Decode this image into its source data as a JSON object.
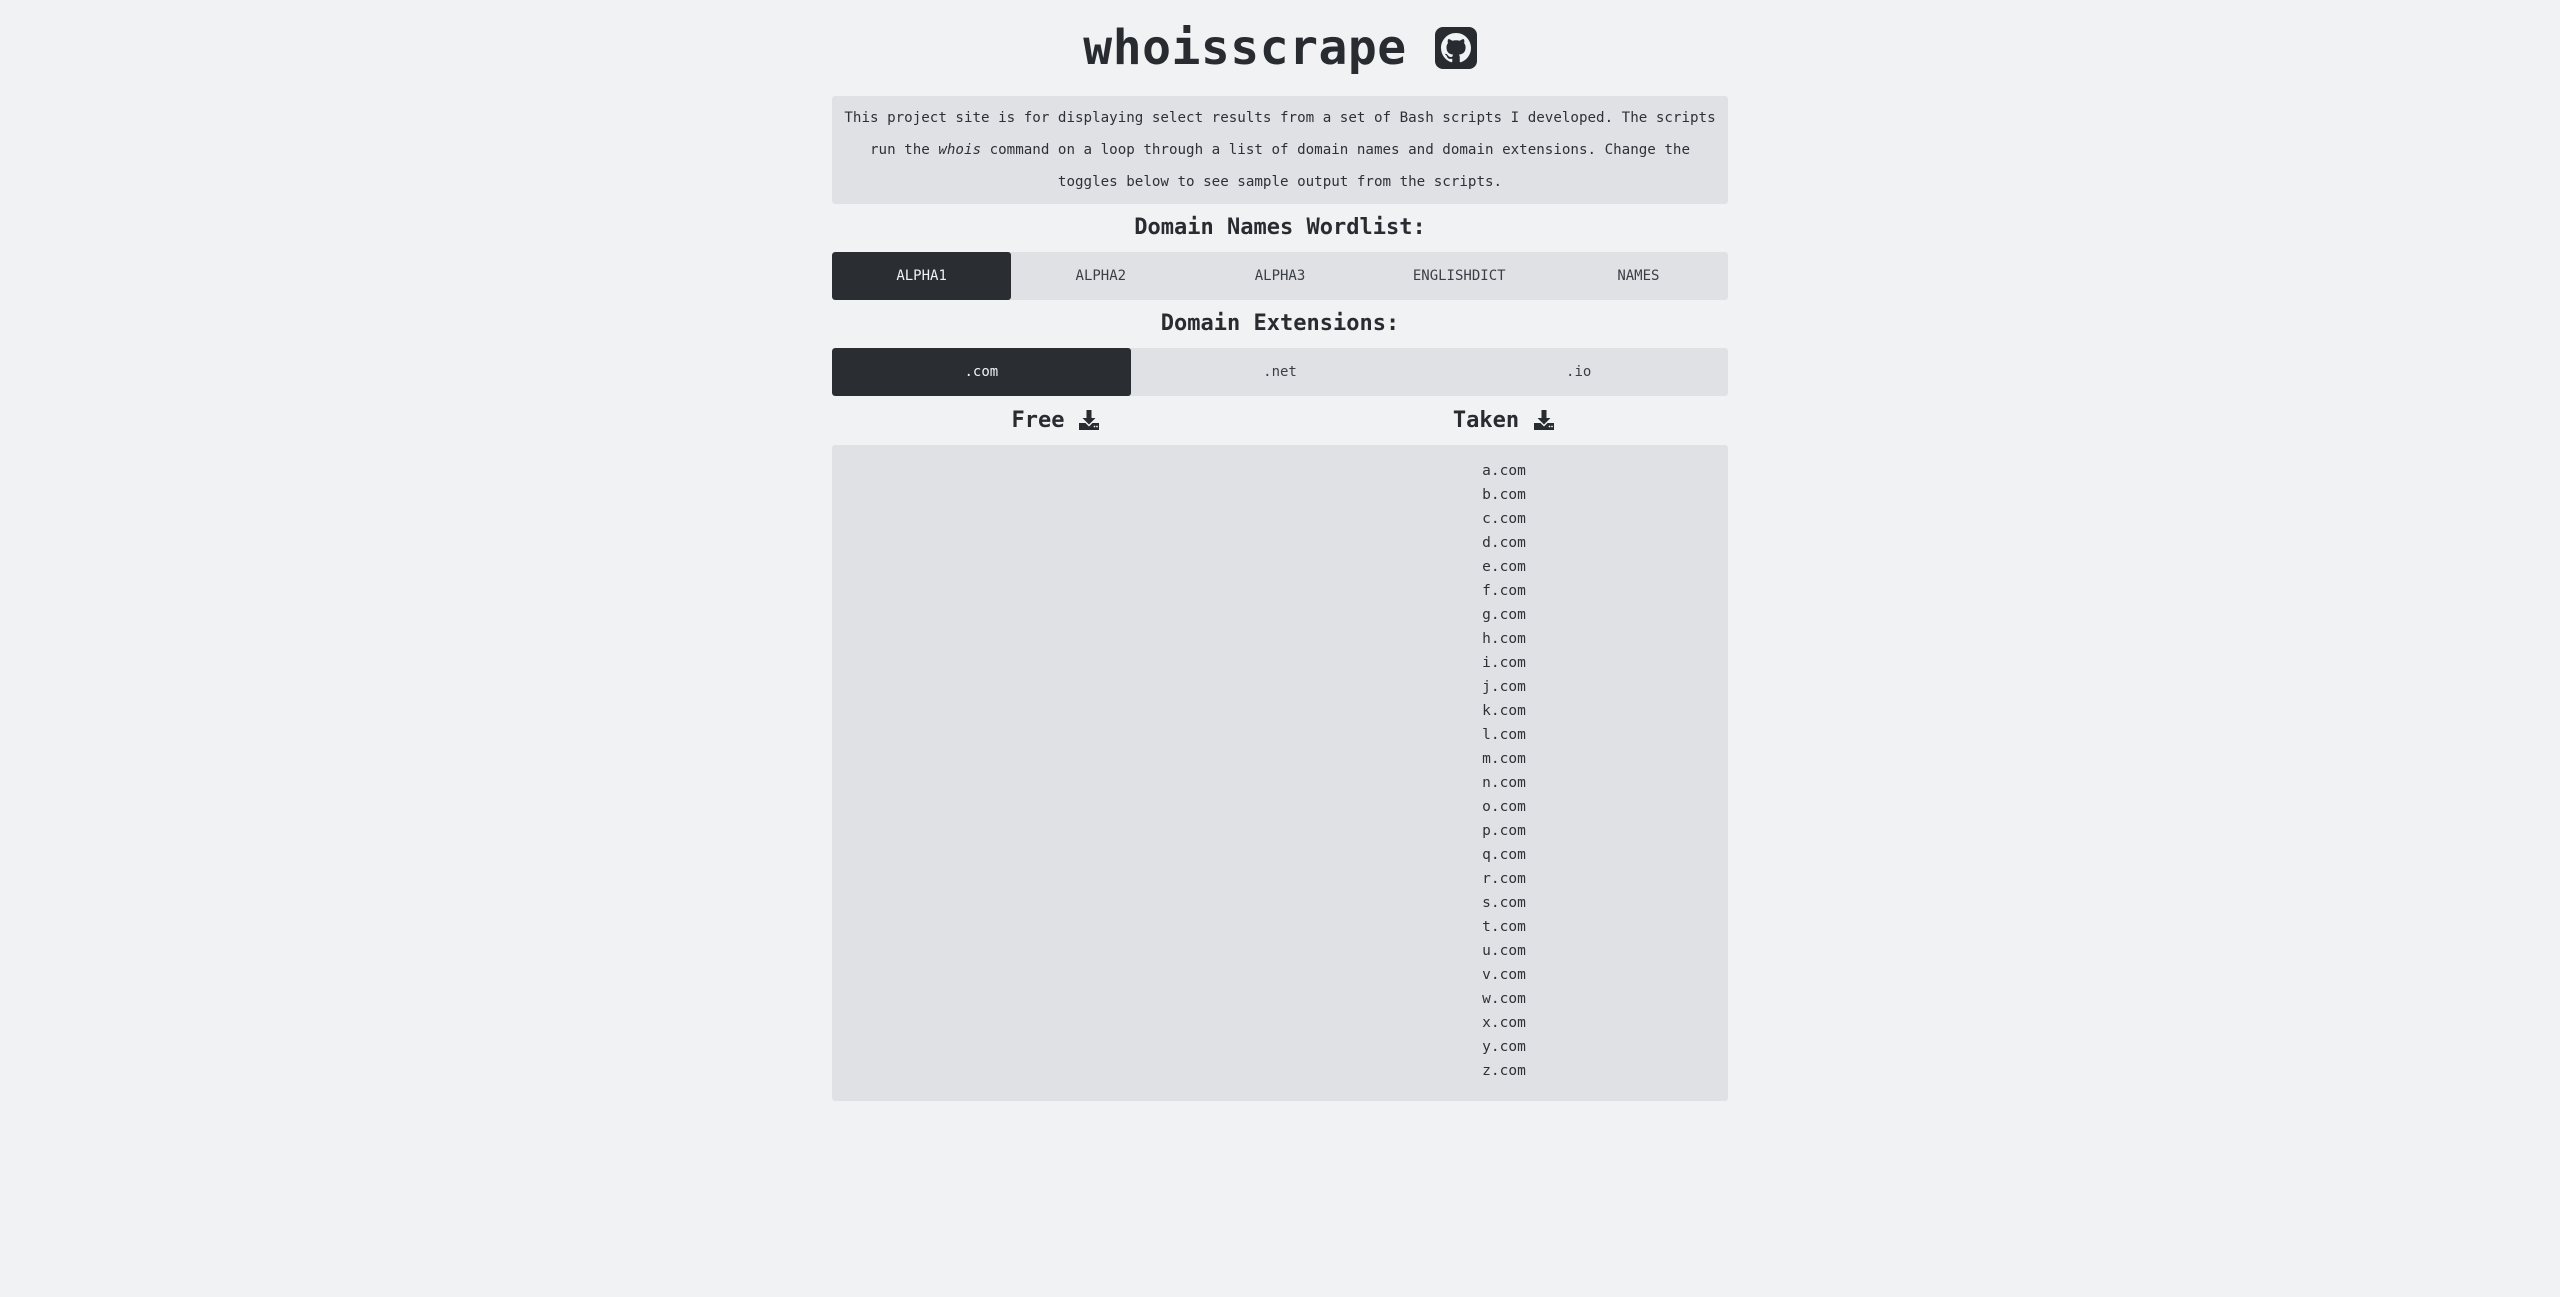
{
  "header": {
    "title": "whoisscrape",
    "github_icon": "github-icon"
  },
  "intro": {
    "part1": "This project site is for displaying select results from a set of Bash scripts I developed. The scripts run the ",
    "command": "whois",
    "part2": " command on a loop through a list of domain names and domain extensions. Change the toggles below to see sample output from the scripts."
  },
  "wordlist": {
    "heading": "Domain Names Wordlist:",
    "options": [
      "ALPHA1",
      "ALPHA2",
      "ALPHA3",
      "ENGLISHDICT",
      "NAMES"
    ],
    "selected": "ALPHA1"
  },
  "extensions": {
    "heading": "Domain Extensions:",
    "options": [
      ".com",
      ".net",
      ".io"
    ],
    "selected": ".com"
  },
  "results": {
    "free_label": "Free",
    "taken_label": "Taken",
    "download_icon": "download-icon",
    "free": [],
    "taken": [
      "a.com",
      "b.com",
      "c.com",
      "d.com",
      "e.com",
      "f.com",
      "g.com",
      "h.com",
      "i.com",
      "j.com",
      "k.com",
      "l.com",
      "m.com",
      "n.com",
      "o.com",
      "p.com",
      "q.com",
      "r.com",
      "s.com",
      "t.com",
      "u.com",
      "v.com",
      "w.com",
      "x.com",
      "y.com",
      "z.com"
    ]
  },
  "colors": {
    "background": "#f1f2f4",
    "panel": "#dfe1e5",
    "dark": "#2a2e33"
  }
}
